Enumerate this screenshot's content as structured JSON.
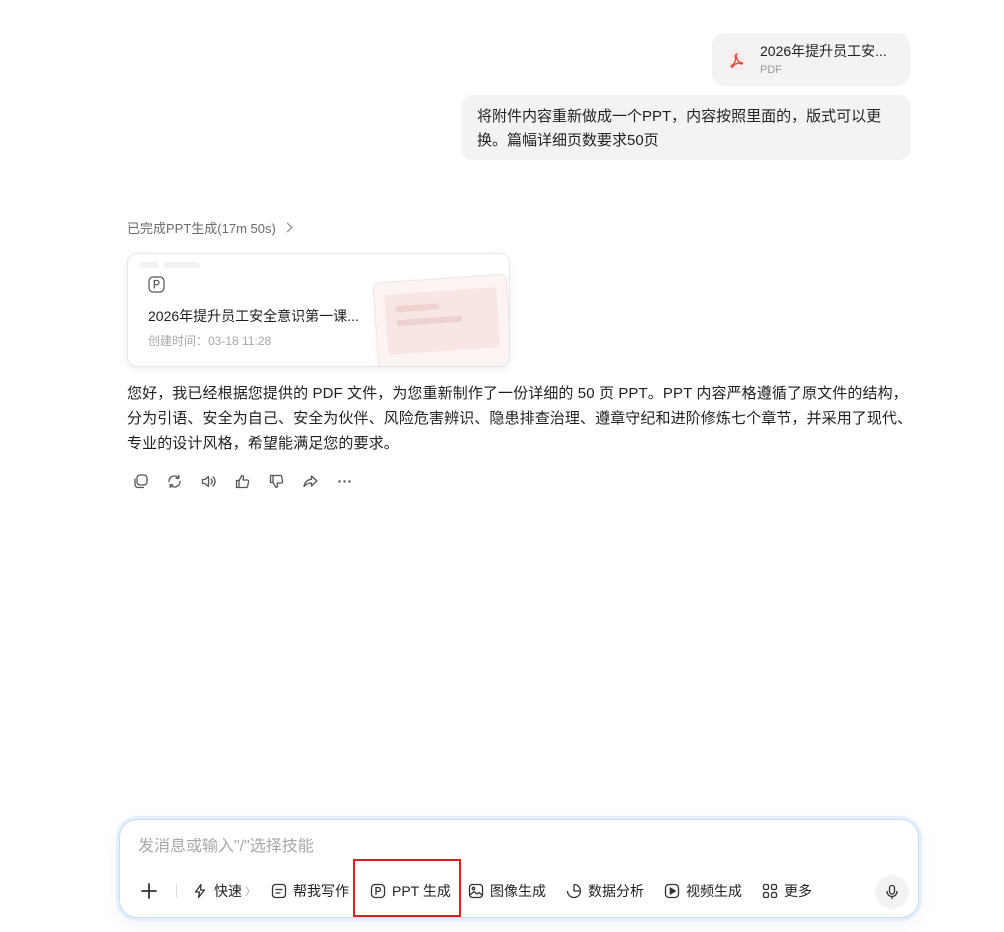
{
  "attachment": {
    "name": "2026年提升员工安...",
    "type": "PDF",
    "icon": "pdf-icon"
  },
  "user_message": "将附件内容重新做成一个PPT，内容按照里面的，版式可以更换。篇幅详细页数要求50页",
  "status": {
    "label": "已完成PPT生成(17m 50s)",
    "icon": "chevron-right-icon"
  },
  "ppt_card": {
    "icon": "ppt-icon",
    "title": "2026年提升员工安全意识第一课...",
    "created": "创建时间：03-18 11:28"
  },
  "reply": "您好，我已经根据您提供的 PDF 文件，为您重新制作了一份详细的 50 页 PPT。PPT 内容严格遵循了原文件的结构，分为引语、安全为自己、安全为伙伴、风险危害辨识、隐患排查治理、遵章守纪和进阶修炼七个章节，并采用了现代、专业的设计风格，希望能满足您的要求。",
  "actions": [
    "copy-icon",
    "regenerate-icon",
    "read-aloud-icon",
    "thumbs-up-icon",
    "thumbs-down-icon",
    "share-icon",
    "more-icon"
  ],
  "composer": {
    "placeholder": "发消息或输入\"/\"选择技能",
    "tools": {
      "quick": "快速",
      "write": "帮我写作",
      "ppt": "PPT 生成",
      "image": "图像生成",
      "data": "数据分析",
      "video": "视频生成",
      "more": "更多"
    }
  },
  "colors": {
    "bubble_bg": "#f3f3f4",
    "accent_border": "#c5dcf5",
    "highlight": "#d32424",
    "pdf_red": "#e04a3f"
  }
}
